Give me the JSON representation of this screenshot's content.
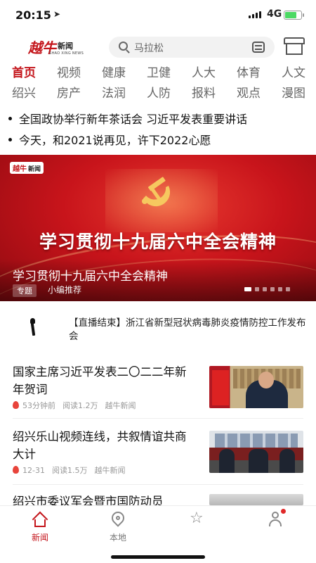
{
  "status_bar": {
    "time": "20:15",
    "network": "4G",
    "battery_level": 0.75,
    "battery_color": "#4cd964"
  },
  "header": {
    "brand": "越牛",
    "brand_suffix": "新闻",
    "brand_sub": "SHAO XING NEWS",
    "search_placeholder": "马拉松",
    "icons": [
      "search-icon",
      "scan-icon",
      "store-icon"
    ]
  },
  "channels_row1": [
    "首页",
    "视频",
    "健康",
    "卫健",
    "人大",
    "体育",
    "人文"
  ],
  "channels_row2": [
    "绍兴",
    "房产",
    "法润",
    "人防",
    "报料",
    "观点",
    "漫图"
  ],
  "active_channel": "首页",
  "headlines": [
    "全国政协举行新年茶话会 习近平发表重要讲话",
    "今天，和2021说再见，许下2022心愿"
  ],
  "banner": {
    "logo_brand": "越牛",
    "logo_suffix": "新闻",
    "big_title": "学习贯彻十九届六中全会精神",
    "caption": "学习贯彻十九届六中全会精神",
    "tag": "专题",
    "source": "小编推荐",
    "slide_count": 6,
    "active_slide": 0
  },
  "live_notice": {
    "text": "【直播结束】浙江省新型冠状病毒肺炎疫情防控工作发布会"
  },
  "news": [
    {
      "title": "国家主席习近平发表二〇二二年新年贺词",
      "time": "53分钟前",
      "reads": "阅读1.2万",
      "source": "越牛新闻"
    },
    {
      "title": "绍兴乐山视频连线，共叙情谊共商大计",
      "time": "12-31",
      "reads": "阅读1.5万",
      "source": "越牛新闻"
    },
    {
      "title": "绍兴市委议军会暨市国防动员"
    }
  ],
  "tabbar": {
    "items": [
      {
        "label": "新闻",
        "icon": "home-icon"
      },
      {
        "label": "本地",
        "icon": "pin-icon"
      },
      {
        "label": "",
        "icon": "star-icon"
      },
      {
        "label": "",
        "icon": "user-icon"
      }
    ],
    "active_index": 0
  },
  "colors": {
    "brand_red": "#c4161c",
    "banner_red": "#c8141b",
    "meta_gray": "#999999"
  }
}
